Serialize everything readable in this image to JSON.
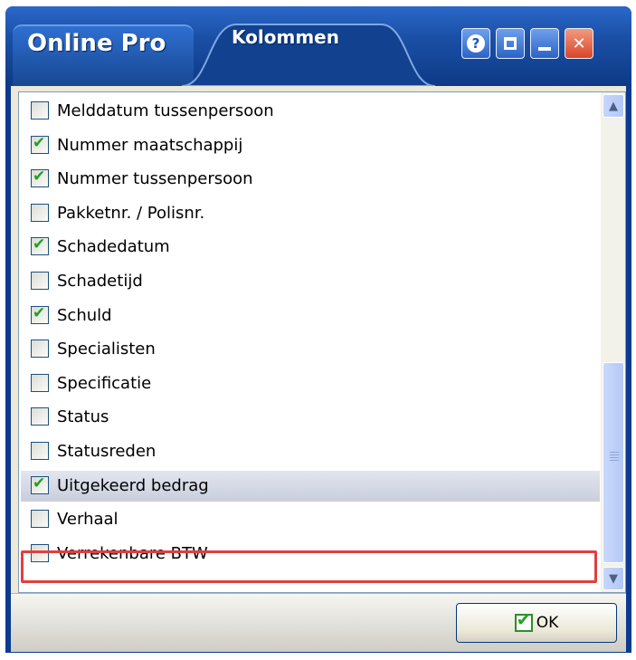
{
  "window": {
    "app_title": "Online Pro",
    "tab_title": "Kolommen",
    "buttons": {
      "help_icon": "?",
      "close_icon": "✕"
    }
  },
  "columns": [
    {
      "label": "Melddatum tussenpersoon",
      "checked": false
    },
    {
      "label": "Nummer maatschappij",
      "checked": true
    },
    {
      "label": "Nummer tussenpersoon",
      "checked": true
    },
    {
      "label": "Pakketnr. / Polisnr.",
      "checked": false
    },
    {
      "label": "Schadedatum",
      "checked": true
    },
    {
      "label": "Schadetijd",
      "checked": false
    },
    {
      "label": "Schuld",
      "checked": true
    },
    {
      "label": "Specialisten",
      "checked": false
    },
    {
      "label": "Specificatie",
      "checked": false
    },
    {
      "label": "Status",
      "checked": false
    },
    {
      "label": "Statusreden",
      "checked": false
    },
    {
      "label": "Uitgekeerd bedrag",
      "checked": true,
      "selected": true
    },
    {
      "label": "Verhaal",
      "checked": false
    },
    {
      "label": "Verrekenbare BTW",
      "checked": false
    }
  ],
  "scrollbar": {
    "up_icon": "▲",
    "down_icon": "▼"
  },
  "footer": {
    "ok_label": "OK"
  },
  "colors": {
    "titlebar": "#1b4fa6",
    "highlight": "#e0403f",
    "check": "#21a121"
  }
}
